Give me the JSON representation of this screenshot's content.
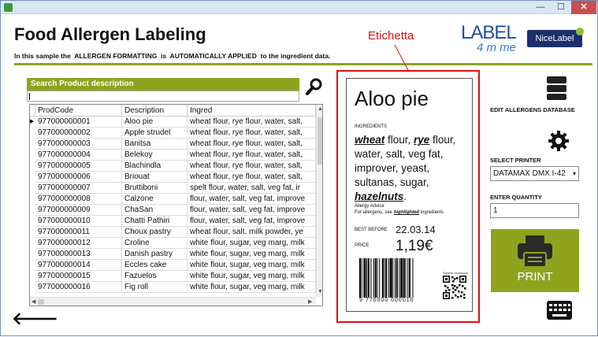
{
  "window": {
    "minimize": "—",
    "maximize": "☐",
    "close": "✕"
  },
  "header": {
    "title": "Food Allergen Labeling",
    "subtitle": "In this sample the  ALLERGEN FORMATTING  is  AUTOMATICALLY APPLIED  to the ingredient data.",
    "logo_label": "LABEL",
    "logo_forme": "4 m me",
    "logo_nicelabel": "NiceLabel",
    "annotation": "Etichetta"
  },
  "search": {
    "header": "Search Product description",
    "value": ""
  },
  "grid": {
    "columns": [
      "ProdCode",
      "Description",
      "Ingred"
    ],
    "rows": [
      [
        "977000000001",
        "Aloo pie",
        "wheat flour, rye flour, water, salt,"
      ],
      [
        "977000000002",
        "Apple strudel",
        "wheat flour, rye flour, water, salt,"
      ],
      [
        "977000000003",
        "Banitsa",
        "wheat flour, rye flour, water, salt,"
      ],
      [
        "977000000004",
        "Belekoy",
        "wheat flour, rye flour, water, salt,"
      ],
      [
        "977000000005",
        "Blachindla",
        "wheat flour, rye flour, water, salt,"
      ],
      [
        "977000000006",
        "Briouat",
        "wheat flour, rye flour, water, salt,"
      ],
      [
        "977000000007",
        "Bruttiboni",
        "spelt flour, water, salt, veg fat, ir"
      ],
      [
        "977000000008",
        "Calzone",
        "flour, water, salt, veg fat, improve"
      ],
      [
        "977000000009",
        "ChaSan",
        "flour, water, salt, veg fat, improve"
      ],
      [
        "977000000010",
        "Chatti Pathiri",
        "flour, water, salt, veg fat, improve"
      ],
      [
        "977000000011",
        "Choux pastry",
        "wheat flour, salt, milk powder, ye"
      ],
      [
        "977000000012",
        "Croline",
        "white flour, sugar, veg marg, milk"
      ],
      [
        "977000000013",
        "Danish pastry",
        "white flour, sugar, veg marg, milk"
      ],
      [
        "977000000014",
        "Eccles cake",
        "white flour, sugar, veg marg, milk"
      ],
      [
        "977000000015",
        "Fazuelos",
        "white flour, sugar, veg marg, milk"
      ],
      [
        "977000000016",
        "Fig roll",
        "white flour, sugar, veg marg, milk"
      ]
    ],
    "selected_marker": "▶"
  },
  "label": {
    "name": "Aloo pie",
    "ingredients_heading": "INGREDIENTS",
    "ingredients": [
      {
        "text": "wheat",
        "bold": true
      },
      {
        "text": " flour, ",
        "bold": false
      },
      {
        "text": "rye",
        "bold": true
      },
      {
        "text": " flour, water, salt, veg fat, improver, yeast, sultanas, sugar, ",
        "bold": false
      },
      {
        "text": "hazelnuts",
        "bold": true
      },
      {
        "text": ".",
        "bold": false
      }
    ],
    "allergy_line1": "Allergy Advice",
    "allergy_line2_pre": "For allergens, see ",
    "allergy_line2_hl": "highlighted",
    "allergy_line2_post": " ingredients",
    "best_before_label": "BEST BEFORE",
    "best_before": "22.03.14",
    "price_label": "PRICE",
    "price": "1,19€",
    "barcode_number": "9 770000 000010",
    "qr_caption": "Sample download"
  },
  "right_panel": {
    "edit_db": "EDIT ALLERGENS DATABASE",
    "select_printer_label": "SELECT PRINTER",
    "printer": "DATAMAX DMX I-42",
    "quantity_label": "ENTER QUANTITY",
    "quantity": "1",
    "print": "PRINT"
  },
  "colors": {
    "accent": "#8fa31e",
    "annotation": "#e01010"
  },
  "icons": [
    "search-icon",
    "database-icon",
    "gear-icon",
    "printer-icon",
    "keyboard-icon",
    "back-arrow-icon"
  ]
}
